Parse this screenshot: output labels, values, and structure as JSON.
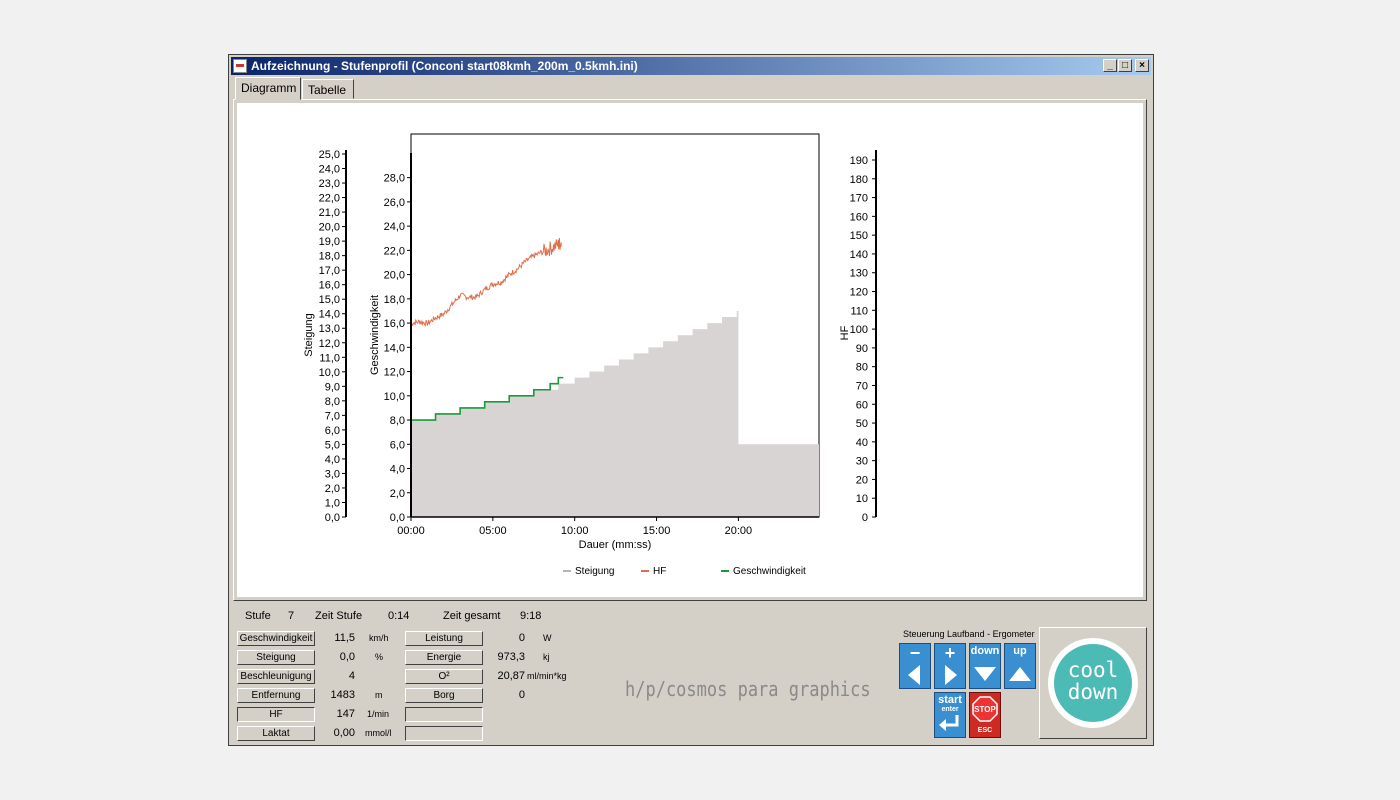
{
  "window": {
    "title": "Aufzeichnung - Stufenprofil (Conconi start08kmh_200m_0.5kmh.ini)",
    "minimize": "_",
    "maximize": "□",
    "close": "×"
  },
  "tabs": [
    {
      "label": "Diagramm",
      "active": true
    },
    {
      "label": "Tabelle",
      "active": false
    }
  ],
  "chart_data": {
    "type": "area",
    "xlabel": "Dauer (mm:ss)",
    "x_ticks": [
      "00:00",
      "05:00",
      "10:00",
      "15:00",
      "20:00"
    ],
    "x_tick_minutes": [
      0,
      5,
      10,
      15,
      20
    ],
    "xlim_minutes": [
      0,
      25
    ],
    "axes": {
      "steigung": {
        "label": "Steigung",
        "ticks": [
          "0,0",
          "1,0",
          "2,0",
          "3,0",
          "4,0",
          "5,0",
          "6,0",
          "7,0",
          "8,0",
          "9,0",
          "10,0",
          "11,0",
          "12,0",
          "13,0",
          "14,0",
          "15,0",
          "16,0",
          "17,0",
          "18,0",
          "19,0",
          "20,0",
          "21,0",
          "22,0",
          "23,0",
          "24,0",
          "25,0"
        ],
        "ylim": [
          0,
          25
        ]
      },
      "geschwindigkeit": {
        "label": "Geschwindigkeit",
        "ticks": [
          "0,0",
          "2,0",
          "4,0",
          "6,0",
          "8,0",
          "10,0",
          "12,0",
          "14,0",
          "16,0",
          "18,0",
          "20,0",
          "22,0",
          "24,0",
          "26,0",
          "28,0"
        ],
        "ylim": [
          0,
          28
        ]
      },
      "hf": {
        "label": "HF",
        "ticks": [
          "0",
          "10",
          "20",
          "30",
          "40",
          "50",
          "60",
          "70",
          "80",
          "90",
          "100",
          "110",
          "120",
          "130",
          "140",
          "150",
          "160",
          "170",
          "180",
          "190"
        ],
        "ylim": [
          0,
          190
        ]
      }
    },
    "series": [
      {
        "name": "Steigung",
        "color": "#d8d4d4",
        "axis": "geschwindigkeit",
        "profile_steps": [
          {
            "start": 0,
            "end": 1.5,
            "value": 8.0
          },
          {
            "start": 1.5,
            "end": 3.0,
            "value": 8.5
          },
          {
            "start": 3.0,
            "end": 4.5,
            "value": 9.0
          },
          {
            "start": 4.5,
            "end": 6.0,
            "value": 9.5
          },
          {
            "start": 6.0,
            "end": 7.5,
            "value": 10.0
          },
          {
            "start": 7.5,
            "end": 9.0,
            "value": 10.5
          },
          {
            "start": 9.0,
            "end": 10.0,
            "value": 11.0
          },
          {
            "start": 10.0,
            "end": 10.9,
            "value": 11.5
          },
          {
            "start": 10.9,
            "end": 11.8,
            "value": 12.0
          },
          {
            "start": 11.8,
            "end": 12.7,
            "value": 12.5
          },
          {
            "start": 12.7,
            "end": 13.6,
            "value": 13.0
          },
          {
            "start": 13.6,
            "end": 14.5,
            "value": 13.5
          },
          {
            "start": 14.5,
            "end": 15.4,
            "value": 14.0
          },
          {
            "start": 15.4,
            "end": 16.3,
            "value": 14.5
          },
          {
            "start": 16.3,
            "end": 17.2,
            "value": 15.0
          },
          {
            "start": 17.2,
            "end": 18.1,
            "value": 15.5
          },
          {
            "start": 18.1,
            "end": 19.0,
            "value": 16.0
          },
          {
            "start": 19.0,
            "end": 19.9,
            "value": 16.5
          },
          {
            "start": 19.9,
            "end": 20.0,
            "value": 17.0
          },
          {
            "start": 20.0,
            "end": 25.0,
            "value": 6.0
          }
        ]
      },
      {
        "name": "HF",
        "color": "#e0704a",
        "axis": "hf",
        "points": [
          [
            0,
            103
          ],
          [
            0.5,
            104
          ],
          [
            1,
            103
          ],
          [
            1.5,
            106
          ],
          [
            2,
            108
          ],
          [
            2.5,
            113
          ],
          [
            3,
            118
          ],
          [
            3.5,
            117
          ],
          [
            4,
            117
          ],
          [
            4.5,
            121
          ],
          [
            5,
            124
          ],
          [
            5.5,
            125
          ],
          [
            6,
            129
          ],
          [
            6.5,
            132
          ],
          [
            7,
            136
          ],
          [
            7.5,
            139
          ],
          [
            8,
            141
          ],
          [
            8.5,
            143
          ],
          [
            9,
            145
          ],
          [
            9.2,
            146
          ]
        ]
      },
      {
        "name": "Geschwindigkeit",
        "color": "#1a9a3a",
        "axis": "geschwindigkeit",
        "steps": [
          [
            0,
            8.0
          ],
          [
            1.5,
            8.5
          ],
          [
            3.0,
            9.0
          ],
          [
            4.5,
            9.5
          ],
          [
            6.0,
            10.0
          ],
          [
            7.5,
            10.5
          ],
          [
            8.5,
            11.0
          ],
          [
            9.0,
            11.5
          ]
        ],
        "end_minutes": 9.3
      }
    ],
    "legend": "bottom"
  },
  "status": {
    "stufe_label": "Stufe",
    "stufe_value": "7",
    "zeit_stufe_label": "Zeit Stufe",
    "zeit_stufe_value": "0:14",
    "zeit_gesamt_label": "Zeit gesamt",
    "zeit_gesamt_value": "9:18"
  },
  "metrics_left": [
    {
      "label": "Geschwindigkeit",
      "value": "11,5",
      "unit": "km/h"
    },
    {
      "label": "Steigung",
      "value": "0,0",
      "unit": "%"
    },
    {
      "label": "Beschleunigung",
      "value": "4",
      "unit": ""
    },
    {
      "label": "Entfernung",
      "value": "1483",
      "unit": "m"
    },
    {
      "label": "HF",
      "value": "147",
      "unit": "1/min"
    },
    {
      "label": "Laktat",
      "value": "0,00",
      "unit": "mmol/l"
    }
  ],
  "metrics_right": [
    {
      "label": "Leistung",
      "value": "0",
      "unit": "W"
    },
    {
      "label": "Energie",
      "value": "973,3",
      "unit": "kj"
    },
    {
      "label": "O²",
      "value": "20,87",
      "unit": "ml/min*kg"
    },
    {
      "label": "Borg",
      "value": "0",
      "unit": ""
    }
  ],
  "brand": "h/p/cosmos para graphics",
  "control": {
    "title": "Steuerung Laufband - Ergometer",
    "minus": "−",
    "plus": "+",
    "down": "down",
    "up": "up",
    "start": "start",
    "enter": "enter",
    "stop": "STOP",
    "esc": "ESC"
  },
  "cool_down": {
    "line1": "cool",
    "line2": "down"
  }
}
